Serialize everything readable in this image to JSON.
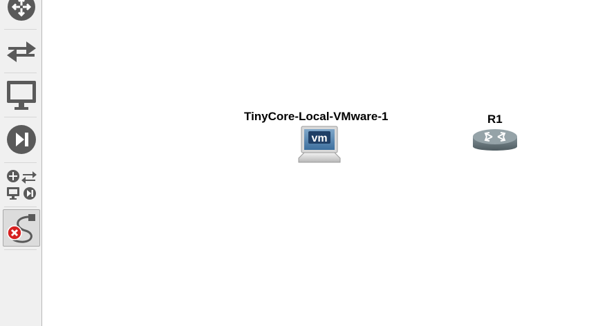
{
  "toolbar": {
    "items": [
      {
        "name": "routers",
        "icon": "router-icon"
      },
      {
        "name": "switches",
        "icon": "switch-arrows-icon"
      },
      {
        "name": "end-devices",
        "icon": "monitor-icon"
      },
      {
        "name": "security-devices",
        "icon": "play-skip-icon"
      },
      {
        "name": "all-devices",
        "icon": "all-devices-icon"
      },
      {
        "name": "add-link",
        "icon": "cable-link-icon",
        "active": true
      }
    ]
  },
  "canvas": {
    "nodes": [
      {
        "label": "TinyCore-Local-VMware-1",
        "icon": "vm-laptop-icon",
        "badge": "vm"
      },
      {
        "label": "R1",
        "icon": "router-icon"
      }
    ]
  },
  "colors": {
    "toolbar_icon": "#5a5a5a",
    "callout_arrow": "#20a187",
    "error_badge": "#d62020",
    "router_body": "#6b7a80"
  }
}
